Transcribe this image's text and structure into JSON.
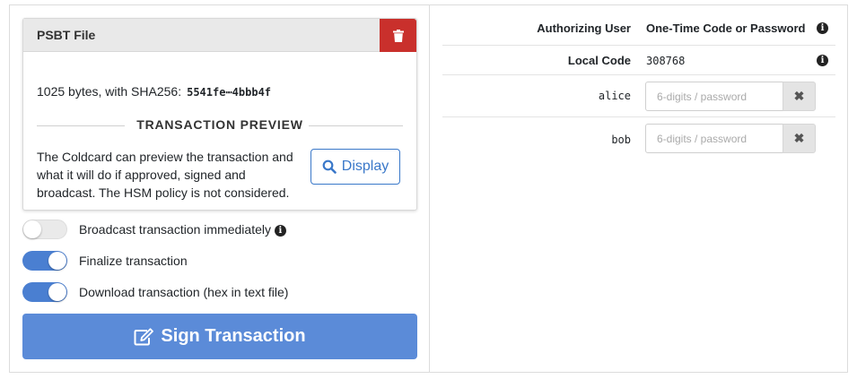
{
  "psbt": {
    "title": "PSBT File",
    "size_text": "1025 bytes, with SHA256:",
    "sha256": "5541fe⋯4bbb4f",
    "preview_heading": "TRANSACTION PREVIEW",
    "preview_text": "The Coldcard can preview the transaction and what it will do if approved, signed and broadcast. The HSM policy is not considered.",
    "display_label": "Display"
  },
  "options": [
    {
      "label": "Broadcast transaction immediately",
      "on": false,
      "info": true
    },
    {
      "label": "Finalize transaction",
      "on": true,
      "info": false
    },
    {
      "label": "Download transaction (hex in text file)",
      "on": true,
      "info": false
    }
  ],
  "sign_label": "Sign Transaction",
  "auth": {
    "col_user": "Authorizing User",
    "col_code": "One-Time Code or Password",
    "local_label": "Local Code",
    "local_code": "308768",
    "users": [
      {
        "name": "alice",
        "placeholder": "6-digits / password",
        "value": ""
      },
      {
        "name": "bob",
        "placeholder": "6-digits / password",
        "value": ""
      }
    ]
  },
  "colors": {
    "danger": "#c9302c",
    "primary": "#5b8bd8",
    "toggle_on": "#4a7fd1"
  }
}
